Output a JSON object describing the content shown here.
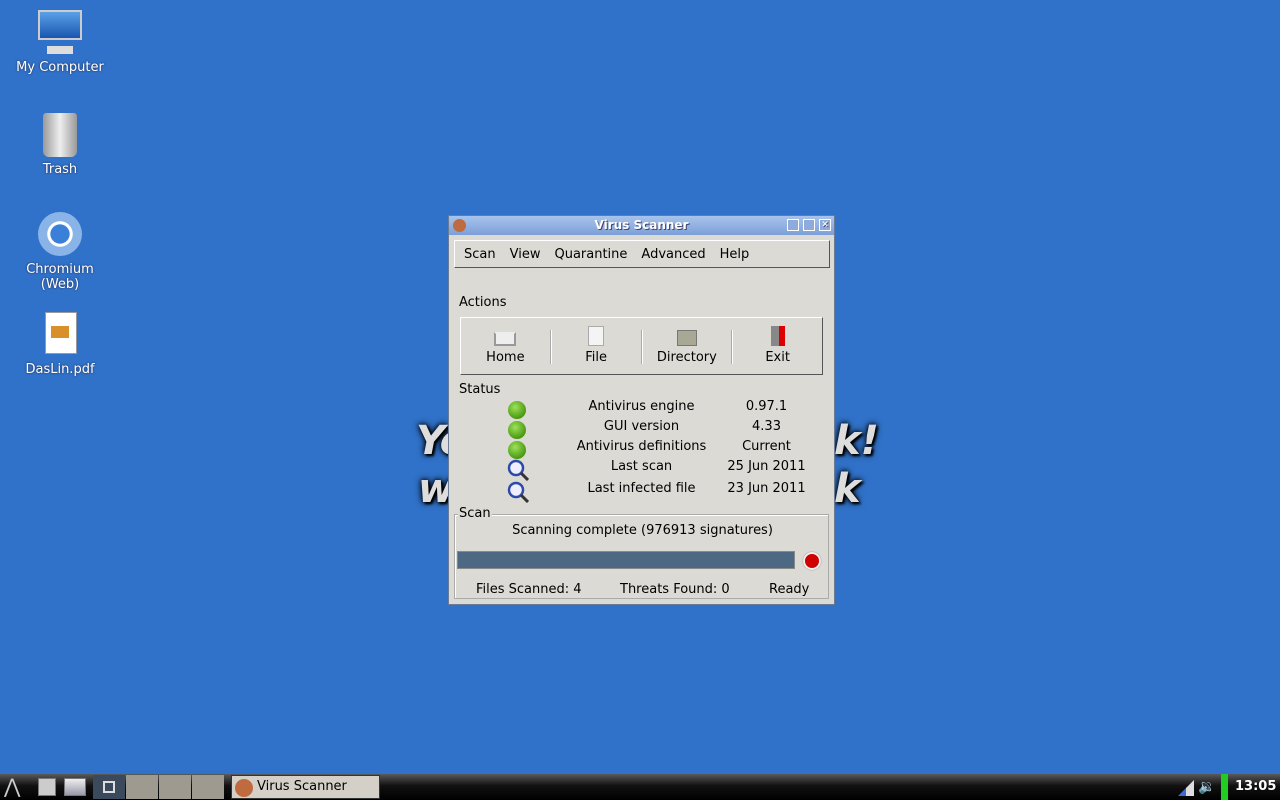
{
  "desktop": {
    "icons": [
      {
        "label": "My Computer",
        "icon": "computer-icon"
      },
      {
        "label": "Trash",
        "icon": "trash-icon"
      },
      {
        "label": "Chromium\n(Web)",
        "icon": "chromium-icon"
      },
      {
        "label": "DasLin.pdf",
        "icon": "pdf-icon"
      }
    ],
    "wallpaper_fragments": [
      "Yo",
      "k!",
      "w",
      "k"
    ]
  },
  "window": {
    "title": "Virus Scanner",
    "menu": [
      "Scan",
      "View",
      "Quarantine",
      "Advanced",
      "Help"
    ],
    "actions_label": "Actions",
    "actions": [
      {
        "label": "Home",
        "icon": "home-icon"
      },
      {
        "label": "File",
        "icon": "file-icon"
      },
      {
        "label": "Directory",
        "icon": "folder-icon"
      },
      {
        "label": "Exit",
        "icon": "exit-icon"
      }
    ],
    "status_label": "Status",
    "status": [
      {
        "key": "Antivirus engine",
        "value": "0.97.1",
        "icon": "green-dot-icon"
      },
      {
        "key": "GUI version",
        "value": "4.33",
        "icon": "green-dot-icon"
      },
      {
        "key": "Antivirus definitions",
        "value": "Current",
        "icon": "green-dot-icon"
      },
      {
        "key": "Last scan",
        "value": "25 Jun 2011",
        "icon": "magnifier-icon"
      },
      {
        "key": "Last infected file",
        "value": "23 Jun 2011",
        "icon": "magnifier-icon"
      }
    ],
    "scan": {
      "label": "Scan",
      "message": "Scanning complete (976913 signatures)",
      "progress_percent": 100,
      "files_scanned": "Files Scanned: 4",
      "threats_found": "Threats Found: 0",
      "state": "Ready"
    }
  },
  "taskbar": {
    "task": "Virus Scanner",
    "clock": "13:05",
    "colors": {
      "indicator": "#22cc22"
    }
  }
}
